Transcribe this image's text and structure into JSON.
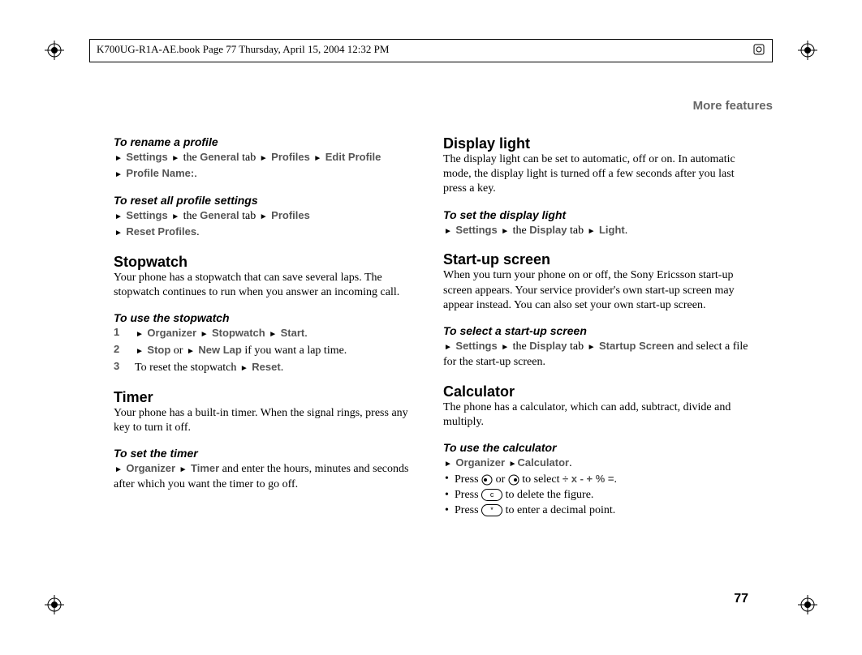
{
  "header": {
    "banner_text": "K700UG-R1A-AE.book  Page 77  Thursday, April 15, 2004  12:32 PM"
  },
  "section_header": "More features",
  "page_number": "77",
  "left": {
    "rename_profile": {
      "title": "To rename a profile",
      "settings": "Settings",
      "the1": "the",
      "general": "General",
      "tab1": "tab",
      "profiles": "Profiles",
      "edit_profile": "Edit Profile",
      "profile_name": "Profile Name:"
    },
    "reset_profile": {
      "title": "To reset all profile settings",
      "settings": "Settings",
      "the1": "the",
      "general": "General",
      "tab1": "tab",
      "profiles": "Profiles",
      "reset_profiles": "Reset Profiles"
    },
    "stopwatch": {
      "heading": "Stopwatch",
      "body": "Your phone has a stopwatch that can save several laps. The stopwatch continues to run when you answer an incoming call.",
      "use_title": "To use the stopwatch",
      "s1n": "1",
      "s1_org": "Organizer",
      "s1_sw": "Stopwatch",
      "s1_start": "Start",
      "s2n": "2",
      "s2_stop": "Stop",
      "s2_or": "or",
      "s2_newlap": "New Lap",
      "s2_tail": "if you want a lap time.",
      "s3n": "3",
      "s3_text": "To reset the stopwatch",
      "s3_reset": "Reset"
    },
    "timer": {
      "heading": "Timer",
      "body": "Your phone has a built-in timer. When the signal rings, press any key to turn it off.",
      "set_title": "To set the timer",
      "organizer": "Organizer",
      "timer": "Timer",
      "tail": "and enter the hours, minutes and seconds after which you want the timer to go off."
    }
  },
  "right": {
    "display_light": {
      "heading": "Display light",
      "body": "The display light can be set to automatic, off or on. In automatic mode, the display light is turned off a few seconds after you last press a key.",
      "set_title": "To set the display light",
      "settings": "Settings",
      "the1": "the",
      "display": "Display",
      "tab1": "tab",
      "light": "Light"
    },
    "startup": {
      "heading": "Start-up screen",
      "body": "When you turn your phone on or off, the Sony Ericsson start-up screen appears. Your service provider's own start-up screen may appear instead. You can also set your own start-up screen.",
      "select_title": "To select a start-up screen",
      "settings": "Settings",
      "the1": "the",
      "display": "Display",
      "tab1": "tab",
      "startup_screen": "Startup Screen",
      "tail": "and select a file for the start-up screen."
    },
    "calculator": {
      "heading": "Calculator",
      "body": "The phone has a calculator, which can add, subtract, divide and multiply.",
      "use_title": "To use the calculator",
      "organizer": "Organizer",
      "calc": "Calculator",
      "b1_press": "Press",
      "b1_or": "or",
      "b1_select": "to select",
      "b1_ops": "÷ x - + % =",
      "b2_press": "Press",
      "b2_key": "c",
      "b2_tail": "to delete the figure.",
      "b3_press": "Press",
      "b3_key": "*",
      "b3_tail": "to enter a decimal point."
    }
  }
}
